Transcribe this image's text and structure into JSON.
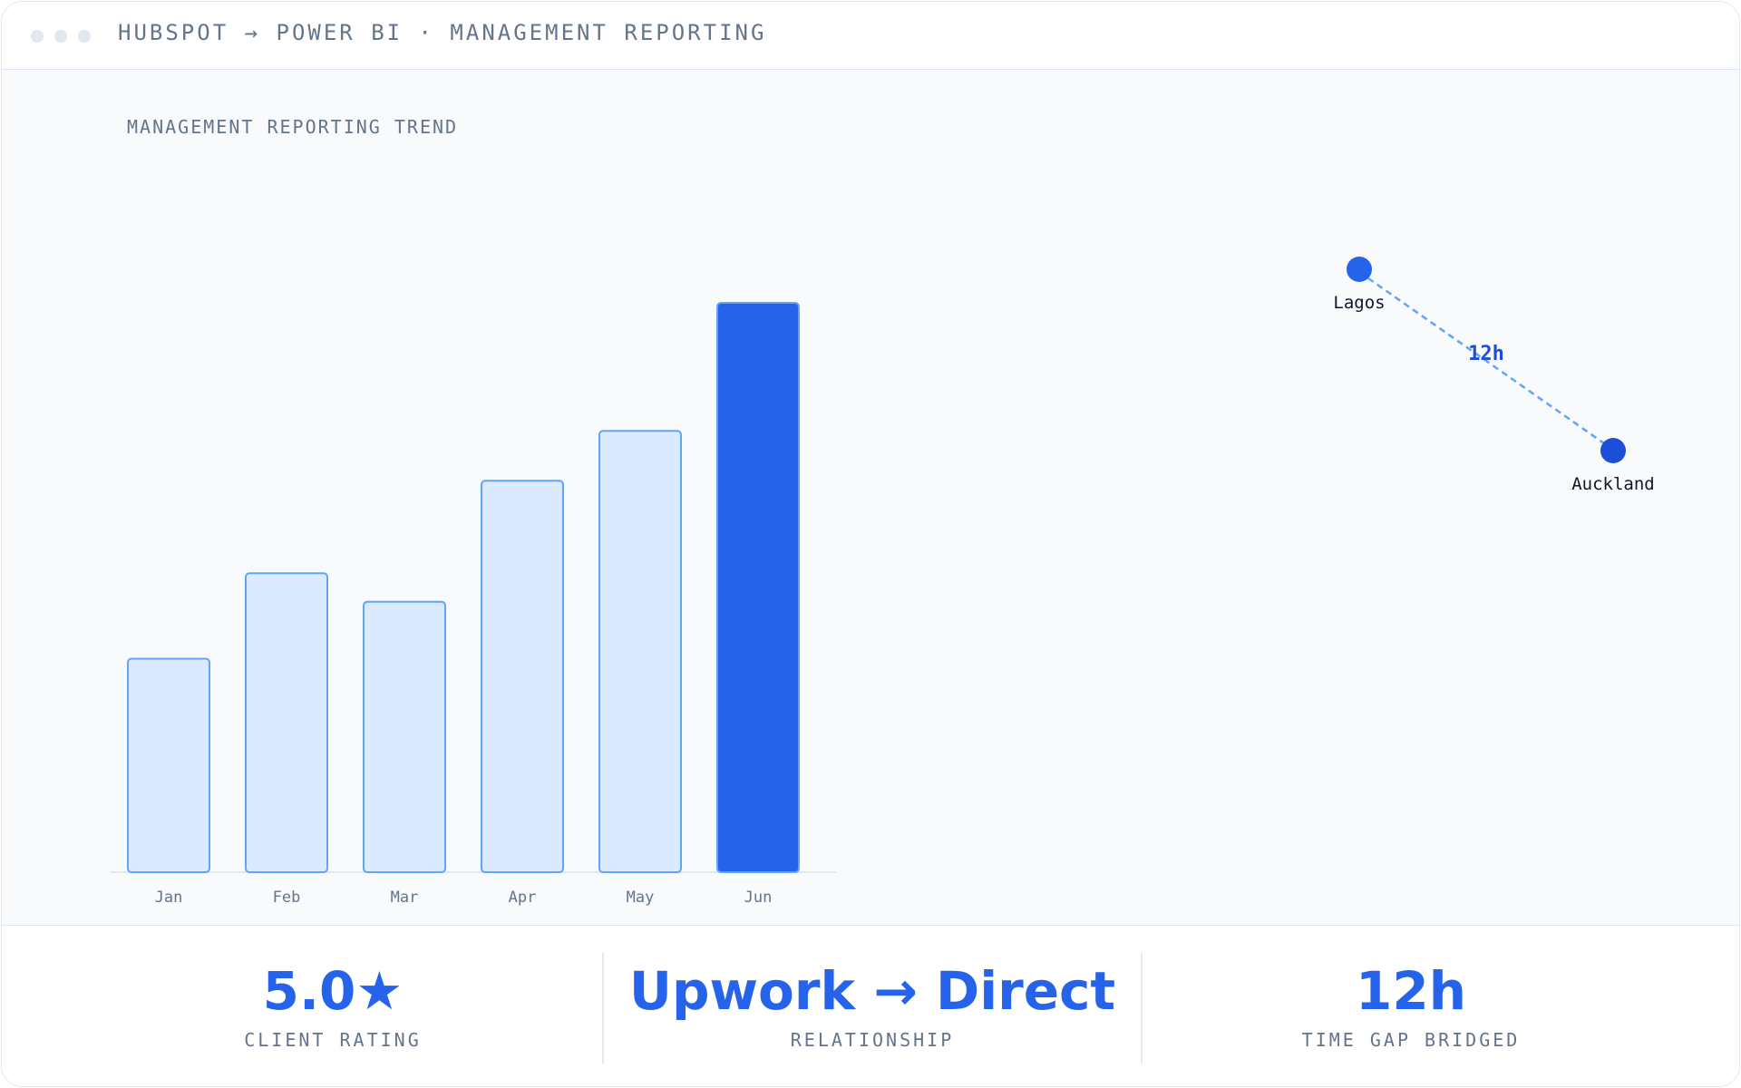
{
  "window": {
    "title": "HUBSPOT → POWER BI · MANAGEMENT REPORTING"
  },
  "chart_title": "MANAGEMENT REPORTING TREND",
  "chart_data": {
    "type": "bar",
    "categories": [
      "Jan",
      "Feb",
      "Mar",
      "Apr",
      "May",
      "Jun"
    ],
    "values": [
      30,
      42,
      38,
      55,
      62,
      80
    ],
    "highlight_index": 5,
    "ylim": [
      0,
      80
    ],
    "grid": false,
    "colors": {
      "bar_fill": "#dbeafe",
      "bar_stroke": "#60a5fa",
      "highlight_fill": "#2563eb",
      "axis": "#e2e8f0"
    }
  },
  "connection": {
    "from": "Lagos",
    "to": "Auckland",
    "gap_label": "12h",
    "colors": {
      "from_dot": "#2563eb",
      "to_dot": "#1d4ed8",
      "line": "#60a5fa",
      "gap_text": "#1d4ed8"
    }
  },
  "stats": [
    {
      "value": "5.0★",
      "label": "CLIENT RATING"
    },
    {
      "value": "Upwork → Direct",
      "label": "RELATIONSHIP"
    },
    {
      "value": "12h",
      "label": "TIME GAP BRIDGED"
    }
  ]
}
